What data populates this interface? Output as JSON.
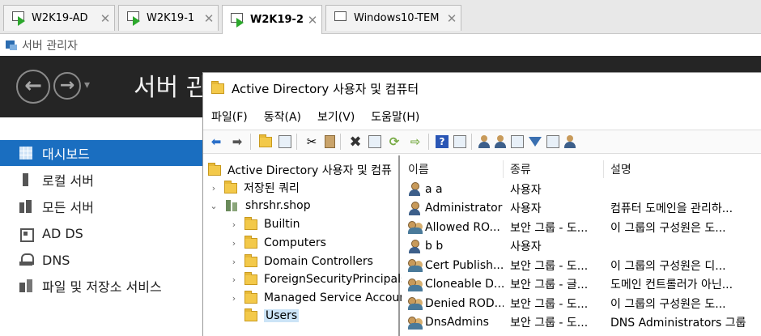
{
  "vm_tabs": [
    {
      "label": "W2K19-AD",
      "active": false
    },
    {
      "label": "W2K19-1",
      "active": false
    },
    {
      "label": "W2K19-2",
      "active": true
    },
    {
      "label": "Windows10-TEM",
      "active": false
    }
  ],
  "tab_close_glyph": "✕",
  "server_manager": {
    "window_title": "서버 관리자",
    "header_title": "서버 관리",
    "nav": [
      {
        "label": "대시보드",
        "icon": "dashboard-icon"
      },
      {
        "label": "로컬 서버",
        "icon": "local-server-icon"
      },
      {
        "label": "모든 서버",
        "icon": "all-servers-icon"
      },
      {
        "label": "AD DS",
        "icon": "ad-ds-icon"
      },
      {
        "label": "DNS",
        "icon": "dns-icon"
      },
      {
        "label": "파일 및 저장소 서비스",
        "icon": "file-storage-icon"
      }
    ]
  },
  "ad_window": {
    "title": "Active Directory 사용자 및 컴퓨터",
    "menu": [
      "파일(F)",
      "동작(A)",
      "보기(V)",
      "도움말(H)"
    ],
    "tree": {
      "root": "Active Directory 사용자 및 컴퓨",
      "saved_queries": "저장된 쿼리",
      "domain": "shrshr.shop",
      "children": [
        "Builtin",
        "Computers",
        "Domain Controllers",
        "ForeignSecurityPrincipals",
        "Managed Service Accour",
        "Users"
      ]
    },
    "list": {
      "columns": [
        "이름",
        "종류",
        "설명"
      ],
      "rows": [
        {
          "icon": "user-icon",
          "name": "a a",
          "type": "사용자",
          "desc": ""
        },
        {
          "icon": "user-icon",
          "name": "Administrator",
          "type": "사용자",
          "desc": "컴퓨터 도메인을 관리하..."
        },
        {
          "icon": "group-icon",
          "name": "Allowed RO...",
          "type": "보안 그룹 - 도...",
          "desc": "이 그룹의 구성원은 도..."
        },
        {
          "icon": "user-icon",
          "name": "b b",
          "type": "사용자",
          "desc": ""
        },
        {
          "icon": "group-icon",
          "name": "Cert Publish...",
          "type": "보안 그룹 - 도...",
          "desc": "이 그룹의 구성원은 디..."
        },
        {
          "icon": "group-icon",
          "name": "Cloneable D...",
          "type": "보안 그룹 - 글...",
          "desc": "도메인 컨트롤러가 아닌..."
        },
        {
          "icon": "group-icon",
          "name": "Denied ROD...",
          "type": "보안 그룹 - 도...",
          "desc": "이 그룹의 구성원은 도..."
        },
        {
          "icon": "group-icon",
          "name": "DnsAdmins",
          "type": "보안 그룹 - 도...",
          "desc": "DNS Administrators 그룹"
        }
      ]
    }
  }
}
